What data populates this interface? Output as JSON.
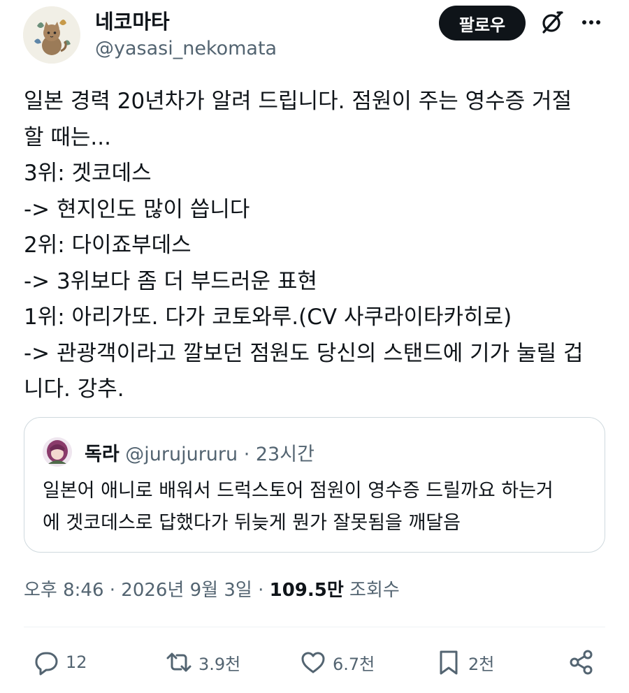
{
  "author": {
    "display_name": "네코마타",
    "handle": "@yasasi_nekomata"
  },
  "header": {
    "follow_label": "팔로우",
    "grok_icon": "grok-icon",
    "more_icon": "more-icon"
  },
  "tweet": {
    "lines": [
      "일본 경력 20년차가 알려 드립니다. 점원이 주는 영수증 거절",
      "할 때는...",
      "3위: 겟코데스",
      "-> 현지인도 많이 씁니다",
      "2위: 다이죠부데스",
      "-> 3위보다 좀 더 부드러운 표현",
      "1위: 아리가또. 다가 코토와루.(CV 사쿠라이타카히로)",
      "-> 관광객이라고 깔보던 점원도 당신의 스탠드에 기가 눌릴 겁",
      "니다. 강추."
    ]
  },
  "quote": {
    "name": "독라",
    "meta": " @jurujururu · 23시간",
    "lines": [
      "일본어 애니로 배워서 드럭스토어 점원이 영수증 드릴까요 하는거",
      "에 겟코데스로 답했다가 뒤늦게 뭔가 잘못됨을 깨달음"
    ]
  },
  "meta": {
    "time_date": "오후 8:46 · 2026년 9월 3일 · ",
    "views_count": "109.5만",
    "views_label": " 조회수"
  },
  "actions": {
    "reply_count": "12",
    "retweet_count": "3.9천",
    "like_count": "6.7천",
    "bookmark_count": "2천"
  },
  "colors": {
    "text_primary": "#0f1419",
    "text_secondary": "#536471",
    "border": "#cfd9de",
    "follow_bg": "#0f1419"
  }
}
